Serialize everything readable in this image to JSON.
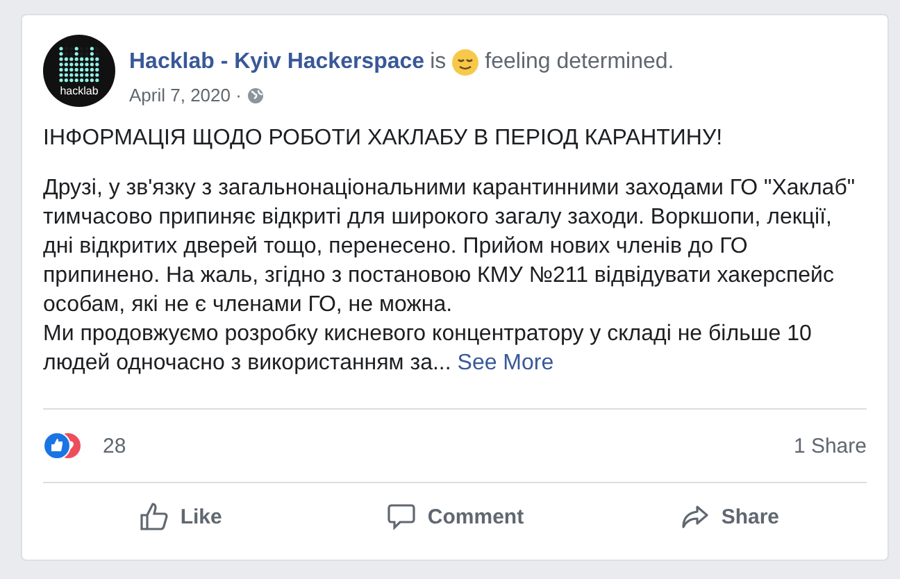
{
  "post": {
    "author": "Hacklab - Kyiv Hackerspace",
    "avatar_label": "hacklab",
    "feeling_prefix": "is",
    "feeling": "feeling determined.",
    "date": "April 7, 2020 ·",
    "headline": "ІНФОРМАЦІЯ ЩОДО РОБОТИ ХАКЛАБУ В ПЕРІОД КАРАНТИНУ!",
    "paragraphs": [
      "Друзі, у зв'язку з загальнонаціональними карантинними заходами ГО \"Хаклаб\" тимчасово припиняє відкриті для широкого загалу заходи. Воркшопи, лекції, дні відкритих дверей тощо, перенесено. Прийом нових членів до ГО припинено. На жаль, згідно з постановою КМУ №211 відвідувати хакерспейс особам, які не є членами ГО, не можна.",
      "Ми продовжуємо розробку кисневого концентратору у складі не більше 10 людей одночасно з використанням за..."
    ],
    "see_more": "See More",
    "reactions_count": "28",
    "shares": "1 Share",
    "actions": [
      {
        "kind": "like",
        "label": "Like"
      },
      {
        "kind": "comment",
        "label": "Comment"
      },
      {
        "kind": "share",
        "label": "Share"
      }
    ]
  }
}
